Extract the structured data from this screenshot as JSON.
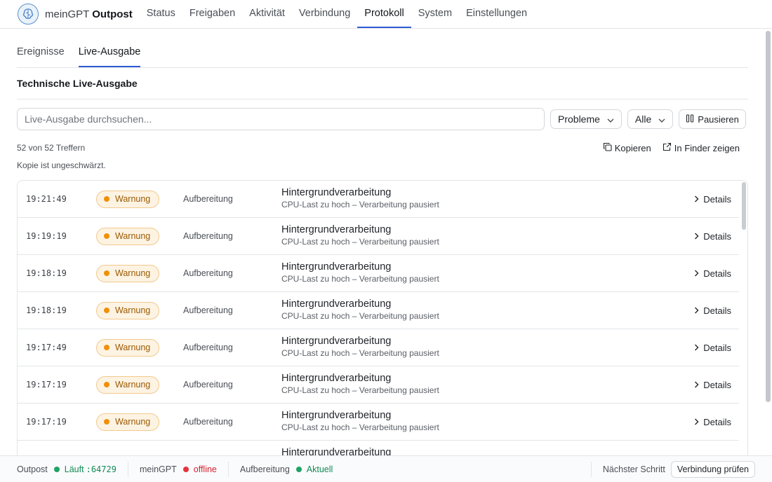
{
  "brand": {
    "name": "meinGPT",
    "product": "Outpost",
    "logo_icon": "brain-logo-icon"
  },
  "nav": {
    "items": [
      {
        "label": "Status",
        "active": false
      },
      {
        "label": "Freigaben",
        "active": false
      },
      {
        "label": "Aktivität",
        "active": false
      },
      {
        "label": "Verbindung",
        "active": false
      },
      {
        "label": "Protokoll",
        "active": true
      },
      {
        "label": "System",
        "active": false
      },
      {
        "label": "Einstellungen",
        "active": false
      }
    ],
    "accent": "#2f5bd3"
  },
  "subtabs": [
    {
      "label": "Ereignisse",
      "active": false
    },
    {
      "label": "Live-Ausgabe",
      "active": true
    }
  ],
  "section_title": "Technische Live-Ausgabe",
  "filters": {
    "search_placeholder": "Live-Ausgabe durchsuchen...",
    "severity_value": "Probleme",
    "scope_value": "Alle",
    "pause_label": "Pausieren"
  },
  "results": {
    "count_text": "52 von 52 Treffern",
    "copy_label": "Kopieren",
    "finder_label": "In Finder zeigen",
    "note": "Kopie ist ungeschwärzt."
  },
  "log_rows": [
    {
      "time": "19:21:49",
      "level": "Warnung",
      "category": "Aufbereitung",
      "title": "Hintergrundverarbeitung",
      "detail": "CPU-Last zu hoch – Verarbeitung pausiert",
      "action": "Details"
    },
    {
      "time": "19:19:19",
      "level": "Warnung",
      "category": "Aufbereitung",
      "title": "Hintergrundverarbeitung",
      "detail": "CPU-Last zu hoch – Verarbeitung pausiert",
      "action": "Details"
    },
    {
      "time": "19:18:19",
      "level": "Warnung",
      "category": "Aufbereitung",
      "title": "Hintergrundverarbeitung",
      "detail": "CPU-Last zu hoch – Verarbeitung pausiert",
      "action": "Details"
    },
    {
      "time": "19:18:19",
      "level": "Warnung",
      "category": "Aufbereitung",
      "title": "Hintergrundverarbeitung",
      "detail": "CPU-Last zu hoch – Verarbeitung pausiert",
      "action": "Details"
    },
    {
      "time": "19:17:49",
      "level": "Warnung",
      "category": "Aufbereitung",
      "title": "Hintergrundverarbeitung",
      "detail": "CPU-Last zu hoch – Verarbeitung pausiert",
      "action": "Details"
    },
    {
      "time": "19:17:19",
      "level": "Warnung",
      "category": "Aufbereitung",
      "title": "Hintergrundverarbeitung",
      "detail": "CPU-Last zu hoch – Verarbeitung pausiert",
      "action": "Details"
    },
    {
      "time": "19:17:19",
      "level": "Warnung",
      "category": "Aufbereitung",
      "title": "Hintergrundverarbeitung",
      "detail": "CPU-Last zu hoch – Verarbeitung pausiert",
      "action": "Details"
    },
    {
      "time": "",
      "level": "",
      "category": "",
      "title": "Hintergrundverarbeitung",
      "detail": "",
      "action": ""
    }
  ],
  "statusbar": {
    "outpost_label": "Outpost",
    "outpost_status": "Läuft",
    "outpost_port": ":64729",
    "meingpt_label": "meinGPT",
    "meingpt_status": "offline",
    "processing_label": "Aufbereitung",
    "processing_status": "Aktuell",
    "next_step_label": "Nächster Schritt",
    "next_step_button": "Verbindung prüfen"
  },
  "colors": {
    "warning_bg": "#fdf3e3",
    "warning_text": "#9a5a00",
    "warning_dot": "#f0900a",
    "ok": "#1fa366",
    "error": "#e5343f"
  }
}
